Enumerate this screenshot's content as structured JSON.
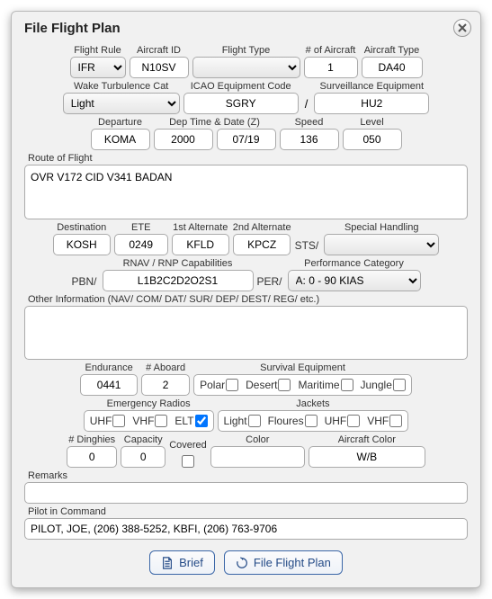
{
  "title": "File Flight Plan",
  "labels": {
    "flight_rule": "Flight Rule",
    "aircraft_id": "Aircraft ID",
    "flight_type": "Flight Type",
    "num_aircraft": "# of Aircraft",
    "aircraft_type": "Aircraft Type",
    "wake_cat": "Wake Turbulence Cat",
    "icao_equip": "ICAO Equipment Code",
    "surv_equip": "Surveillance Equipment",
    "departure": "Departure",
    "dep_time": "Dep Time & Date (Z)",
    "speed": "Speed",
    "level": "Level",
    "route": "Route of Flight",
    "destination": "Destination",
    "ete": "ETE",
    "alt1": "1st Alternate",
    "alt2": "2nd Alternate",
    "special": "Special Handling",
    "rnav": "RNAV / RNP Capabilities",
    "perf_cat": "Performance Category",
    "other_info": "Other Information (NAV/ COM/ DAT/ SUR/ DEP/ DEST/ REG/ etc.)",
    "endurance": "Endurance",
    "aboard": "# Aboard",
    "survival": "Survival Equipment",
    "emerg_radios": "Emergency Radios",
    "jackets": "Jackets",
    "dinghies": "# Dinghies",
    "capacity": "Capacity",
    "covered": "Covered",
    "color": "Color",
    "aircraft_color": "Aircraft Color",
    "remarks": "Remarks",
    "pic": "Pilot in Command"
  },
  "values": {
    "flight_rule": "IFR",
    "aircraft_id": "N10SV",
    "flight_type": "",
    "num_aircraft": "1",
    "aircraft_type": "DA40",
    "wake_cat": "Light",
    "icao_equip": "SGRY",
    "surv_equip": "HU2",
    "departure": "KOMA",
    "dep_time": "2000",
    "dep_date": "07/19",
    "speed": "136",
    "level": "050",
    "route": "OVR V172 CID V341 BADAN",
    "destination": "KOSH",
    "ete": "0249",
    "alt1": "KFLD",
    "alt2": "KPCZ",
    "special": "",
    "pbn": "L1B2C2D2O2S1",
    "perf_cat": "A: 0 - 90 KIAS",
    "other_info": "",
    "endurance": "0441",
    "aboard": "2",
    "dinghies": "0",
    "capacity": "0",
    "dinghy_color": "",
    "aircraft_color": "W/B",
    "remarks": "",
    "pic": "PILOT, JOE, (206) 388-5252, KBFI, (206) 763-9706"
  },
  "chk": {
    "polar": "Polar",
    "desert": "Desert",
    "maritime": "Maritime",
    "jungle": "Jungle",
    "uhf": "UHF",
    "vhf": "VHF",
    "elt": "ELT",
    "light": "Light",
    "floures": "Floures",
    "j_uhf": "UHF",
    "j_vhf": "VHF"
  },
  "prefix": {
    "sts": "STS/",
    "pbn": "PBN/",
    "per": "PER/"
  },
  "buttons": {
    "brief": "Brief",
    "file": "File Flight Plan"
  }
}
